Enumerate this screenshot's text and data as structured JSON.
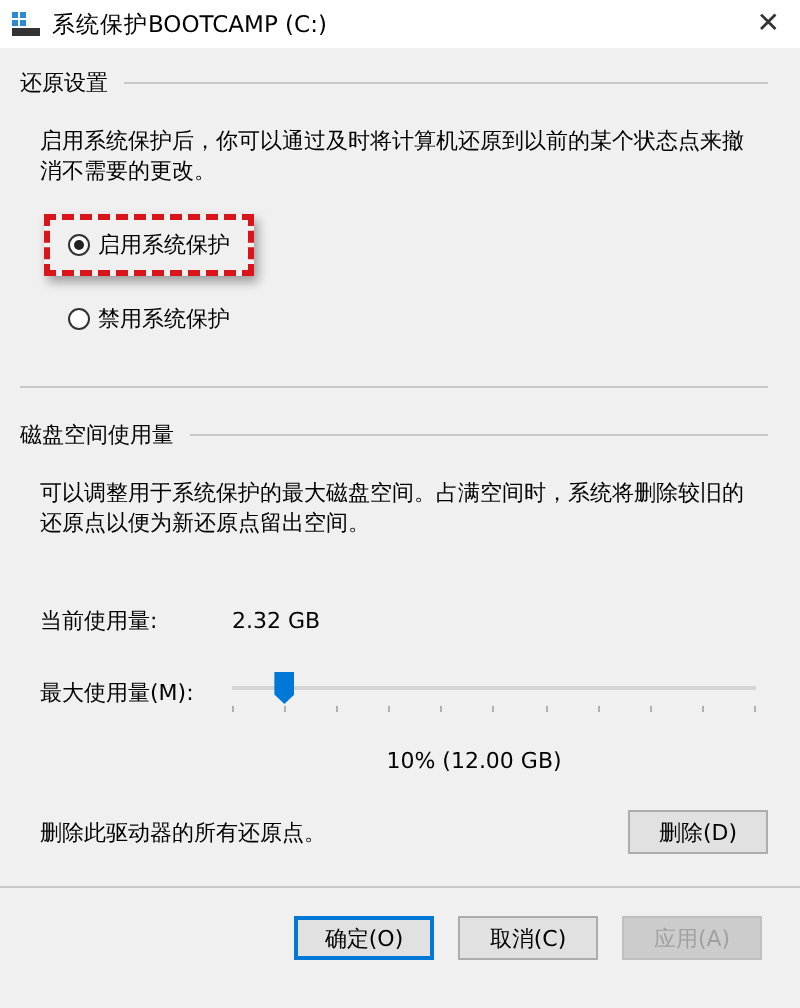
{
  "window": {
    "title": "系统保护BOOTCAMP (C:)",
    "close": "✕"
  },
  "restore_settings": {
    "heading": "还原设置",
    "description": "启用系统保护后，你可以通过及时将计算机还原到以前的某个状态点来撤消不需要的更改。",
    "options": [
      {
        "label": "启用系统保护",
        "selected": true,
        "highlighted": true
      },
      {
        "label": "禁用系统保护",
        "selected": false,
        "highlighted": false
      }
    ]
  },
  "disk_usage": {
    "heading": "磁盘空间使用量",
    "description": "可以调整用于系统保护的最大磁盘空间。占满空间时，系统将删除较旧的还原点以便为新还原点留出空间。",
    "current_label": "当前使用量:",
    "current_value": "2.32 GB",
    "max_label": "最大使用量(M):",
    "slider": {
      "level": 0.1
    },
    "slider_reading": "10% (12.00 GB)",
    "delete_text": "删除此驱动器的所有还原点。",
    "delete_button": "删除(D)"
  },
  "buttons": [
    {
      "label": "确定(O)",
      "default": true,
      "disabled": false
    },
    {
      "label": "取消(C)",
      "default": false,
      "disabled": false
    },
    {
      "label": "应用(A)",
      "default": false,
      "disabled": true
    }
  ]
}
